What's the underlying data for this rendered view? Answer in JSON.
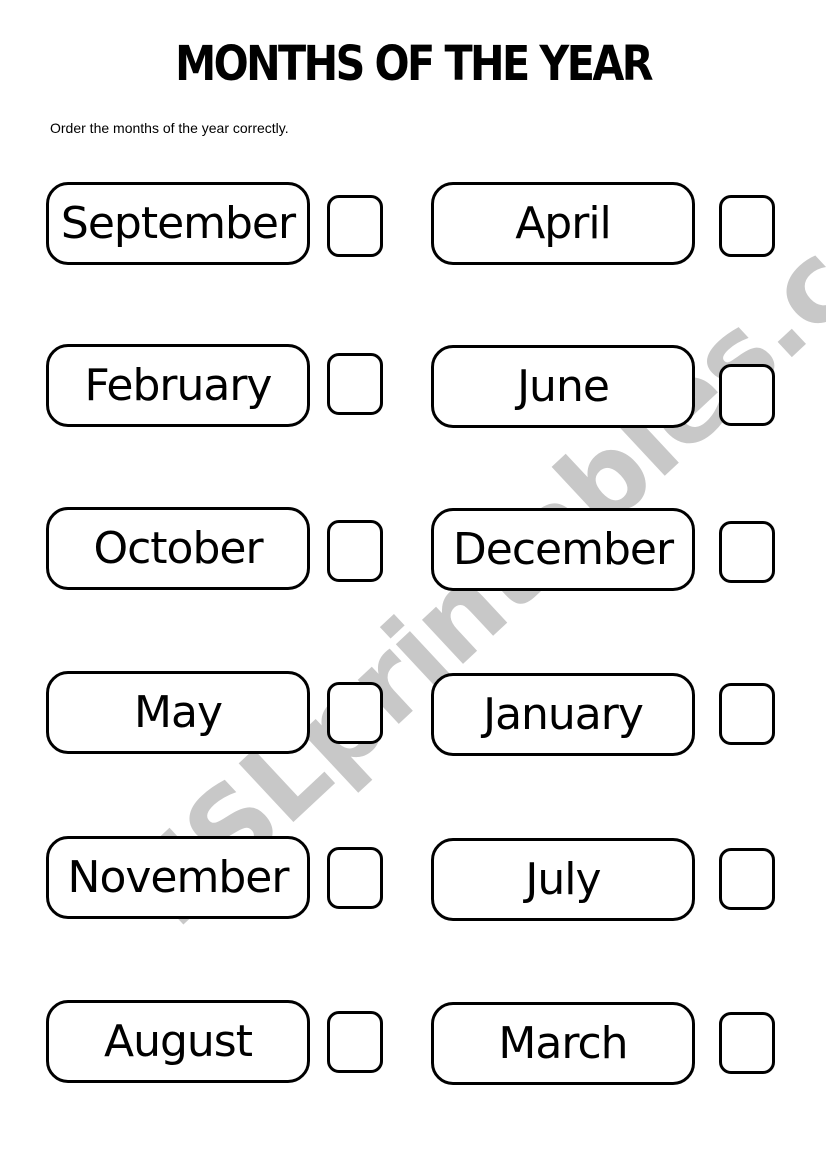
{
  "title": "MONTHS OF THE YEAR",
  "instruction": "Order the months of the year correctly.",
  "watermark": "ESLprintables.com",
  "left_column": [
    {
      "month": "September"
    },
    {
      "month": "February"
    },
    {
      "month": "October"
    },
    {
      "month": "May"
    },
    {
      "month": "November"
    },
    {
      "month": "August"
    }
  ],
  "right_column": [
    {
      "month": "April"
    },
    {
      "month": "June"
    },
    {
      "month": "December"
    },
    {
      "month": "January"
    },
    {
      "month": "July"
    },
    {
      "month": "March"
    }
  ]
}
